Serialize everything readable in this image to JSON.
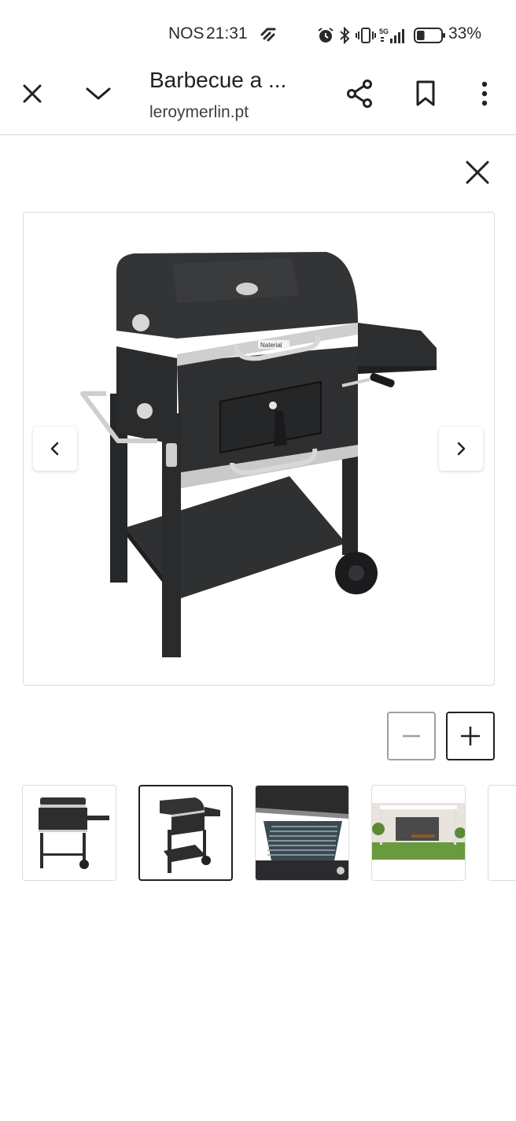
{
  "status_bar": {
    "carrier": "NOS",
    "time": "21:31",
    "battery_percent": "33%",
    "battery_level": 0.33,
    "icons": [
      "data-saver-icon",
      "alarm-icon",
      "bluetooth-icon",
      "vibrate-icon",
      "5g-icon",
      "signal-icon",
      "battery-icon"
    ]
  },
  "toolbar": {
    "title": "Barbecue a ...",
    "url": "leroymerlin.pt",
    "icons": [
      "close-icon",
      "chevron-down-icon",
      "share-icon",
      "bookmark-icon",
      "more-vert-icon"
    ]
  },
  "viewer": {
    "brand_label": "Naterial",
    "prev_icon": "chevron-left-icon",
    "next_icon": "chevron-right-icon",
    "close_icon": "close-icon",
    "zoom_out_icon": "minus-icon",
    "zoom_in_icon": "plus-icon"
  },
  "thumbnails": [
    {
      "name": "thumb-front-view",
      "selected": false
    },
    {
      "name": "thumb-angled-view",
      "selected": true
    },
    {
      "name": "thumb-grill-interior",
      "selected": false
    },
    {
      "name": "thumb-patio-scene",
      "selected": false
    },
    {
      "name": "thumb-partial",
      "selected": false
    }
  ],
  "colors": {
    "grill_body": "#2b2c2e",
    "steel": "#c8c8c8",
    "border": "#dadce0"
  }
}
